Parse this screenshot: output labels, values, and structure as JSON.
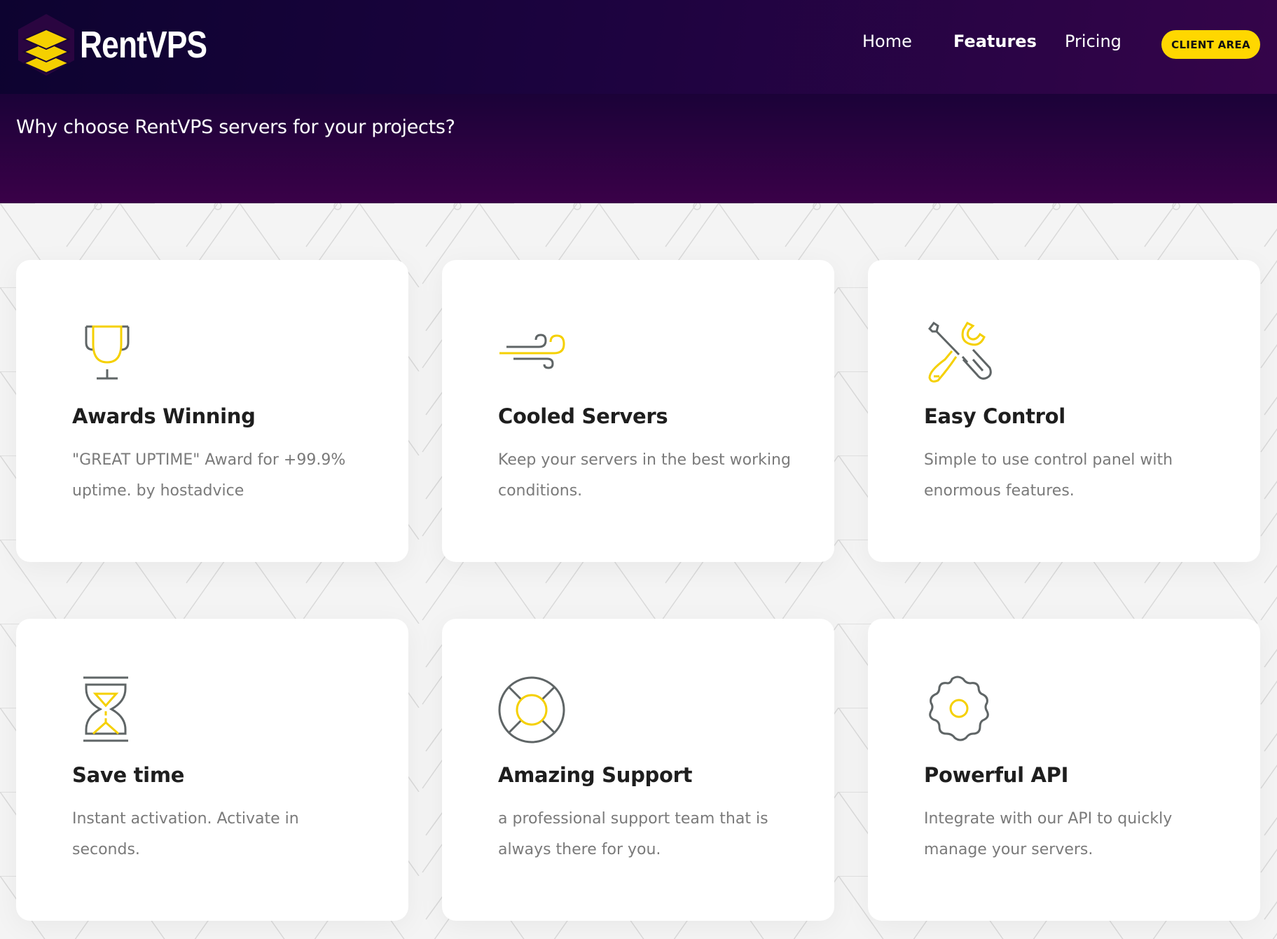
{
  "brand": {
    "name": "RentVPS",
    "logo_icon": "stacked-layers-icon",
    "accent": "#ffd700",
    "dark": "#1a0336"
  },
  "nav": {
    "links": [
      {
        "label": "Home",
        "active": false
      },
      {
        "label": "Features",
        "active": true
      },
      {
        "label": "Pricing",
        "active": false
      }
    ],
    "client_area_label": "CLIENT AREA"
  },
  "hero": {
    "heading": "Why choose RentVPS servers for your projects?"
  },
  "features": [
    {
      "icon": "trophy-icon",
      "title": "Awards Winning",
      "description": "\"GREAT UPTIME\" Award for +99.9% uptime. by hostadvice"
    },
    {
      "icon": "wind-icon",
      "title": "Cooled Servers",
      "description": "Keep your servers in the best working conditions."
    },
    {
      "icon": "tools-icon",
      "title": "Easy Control",
      "description": "Simple to use control panel with enormous features."
    },
    {
      "icon": "hourglass-icon",
      "title": "Save time",
      "description": "Instant activation. Activate in seconds."
    },
    {
      "icon": "lifebuoy-icon",
      "title": "Amazing Support",
      "description": "a professional support team that is always there for you."
    },
    {
      "icon": "gear-icon",
      "title": "Powerful API",
      "description": "Integrate with our API to quickly manage your servers."
    }
  ]
}
